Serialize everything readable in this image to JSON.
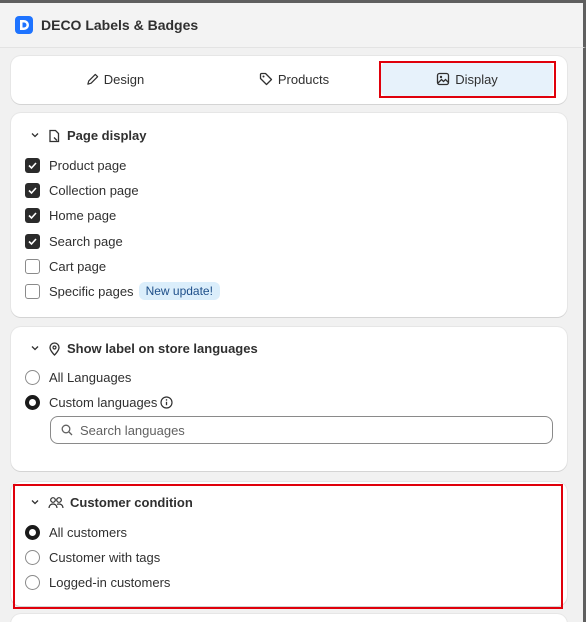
{
  "app": {
    "title": "DECO Labels & Badges",
    "logo_letter": "D"
  },
  "tabs": [
    {
      "label": "Design",
      "icon": "pencil-icon",
      "active": false
    },
    {
      "label": "Products",
      "icon": "tag-icon",
      "active": false
    },
    {
      "label": "Display",
      "icon": "image-icon",
      "active": true
    }
  ],
  "page_display": {
    "title": "Page display",
    "items": [
      {
        "label": "Product page",
        "checked": true
      },
      {
        "label": "Collection page",
        "checked": true
      },
      {
        "label": "Home page",
        "checked": true
      },
      {
        "label": "Search page",
        "checked": true
      },
      {
        "label": "Cart page",
        "checked": false
      },
      {
        "label": "Specific pages",
        "checked": false,
        "badge": "New update!"
      }
    ]
  },
  "languages": {
    "title": "Show label on store languages",
    "options": [
      {
        "label": "All Languages",
        "selected": false
      },
      {
        "label": "Custom languages",
        "selected": true
      }
    ],
    "search_placeholder": "Search languages"
  },
  "customer_condition": {
    "title": "Customer condition",
    "options": [
      {
        "label": "All customers",
        "selected": true
      },
      {
        "label": "Customer with tags",
        "selected": false
      },
      {
        "label": "Logged-in customers",
        "selected": false
      }
    ]
  },
  "colors": {
    "highlight_border": "#e0000b",
    "active_tab_bg": "#e7f2fb",
    "logo_bg": "#1e73ff"
  }
}
